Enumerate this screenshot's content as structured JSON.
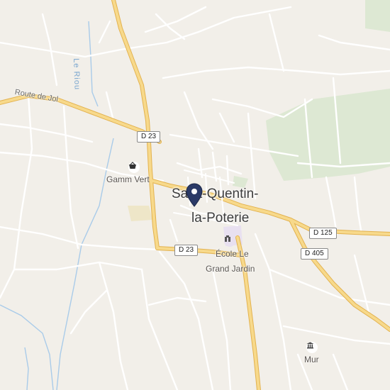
{
  "map": {
    "place_name": "Saint-Quentin-la-Poterie",
    "place_name_line1": "Saint-Quentin-",
    "place_name_line2": "la-Poterie",
    "road_labels": {
      "route_de_jol": "Route de Jol",
      "river": "Le Riou"
    },
    "shields": {
      "d23_north": "D 23",
      "d23_south": "D 23",
      "d125": "D 125",
      "d405": "D 405"
    },
    "pois": {
      "gamm_vert": "Gamm Vert",
      "ecole_line1": "École Le",
      "ecole_line2": "Grand Jardin",
      "mur": "Mur"
    },
    "colors": {
      "background": "#f2efe9",
      "major_road": "#f2c96b",
      "minor_road": "#ffffff",
      "park": "#dde8d3",
      "water": "#a9cbe9",
      "pin": "#2b3a67"
    },
    "icons": {
      "pin": "location-pin-icon",
      "gamm_vert": "shopping-basket-icon",
      "ecole": "school-icon",
      "mur": "landmark-icon"
    }
  }
}
